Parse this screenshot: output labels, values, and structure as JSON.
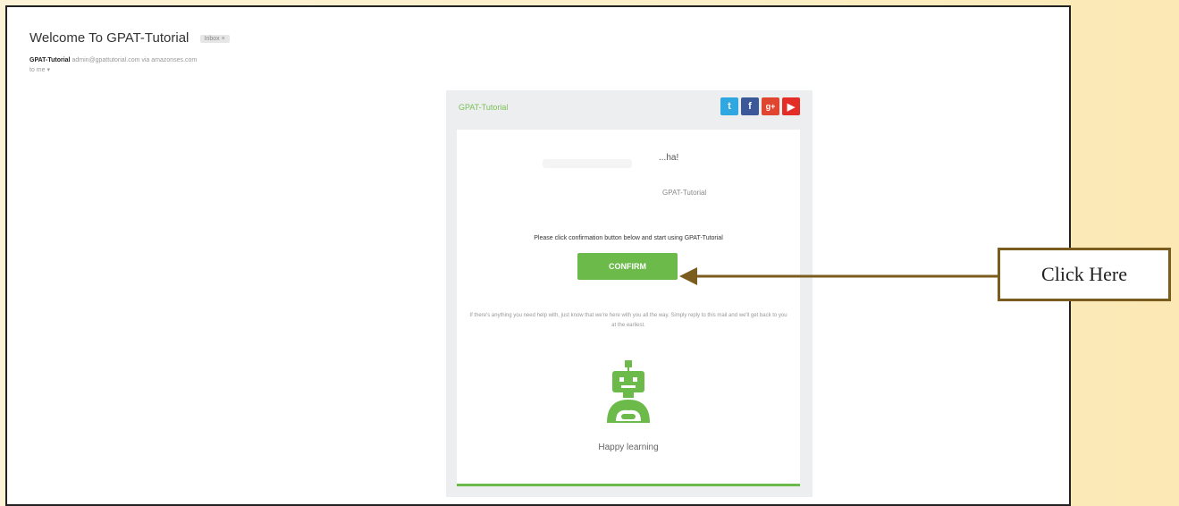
{
  "email": {
    "subject": "Welcome To GPAT-Tutorial",
    "inbox_badge": "Inbox ×",
    "sender_name": "GPAT-Tutorial",
    "sender_address": "admin@gpattutorial.com via amazonses.com",
    "recipient": "to me ▾"
  },
  "card": {
    "brand": "GPAT-Tutorial",
    "greeting": "...ha!",
    "from_name": "GPAT-Tutorial",
    "instruction": "Please click confirmation button below and start using GPAT-Tutorial",
    "confirm_label": "CONFIRM",
    "help_text": "If there's anything you need help with, just know that we're here with you all the way. Simply reply to this mail and we'll get back to you at the earliest.",
    "closing": "Happy learning",
    "social_icons": [
      "twitter-icon",
      "facebook-icon",
      "google-plus-icon",
      "youtube-icon"
    ]
  },
  "callout": {
    "label": "Click Here"
  },
  "colors": {
    "accent_green": "#6cbb4a",
    "callout_border": "#7a5c1e",
    "background": "#fcefc7"
  }
}
